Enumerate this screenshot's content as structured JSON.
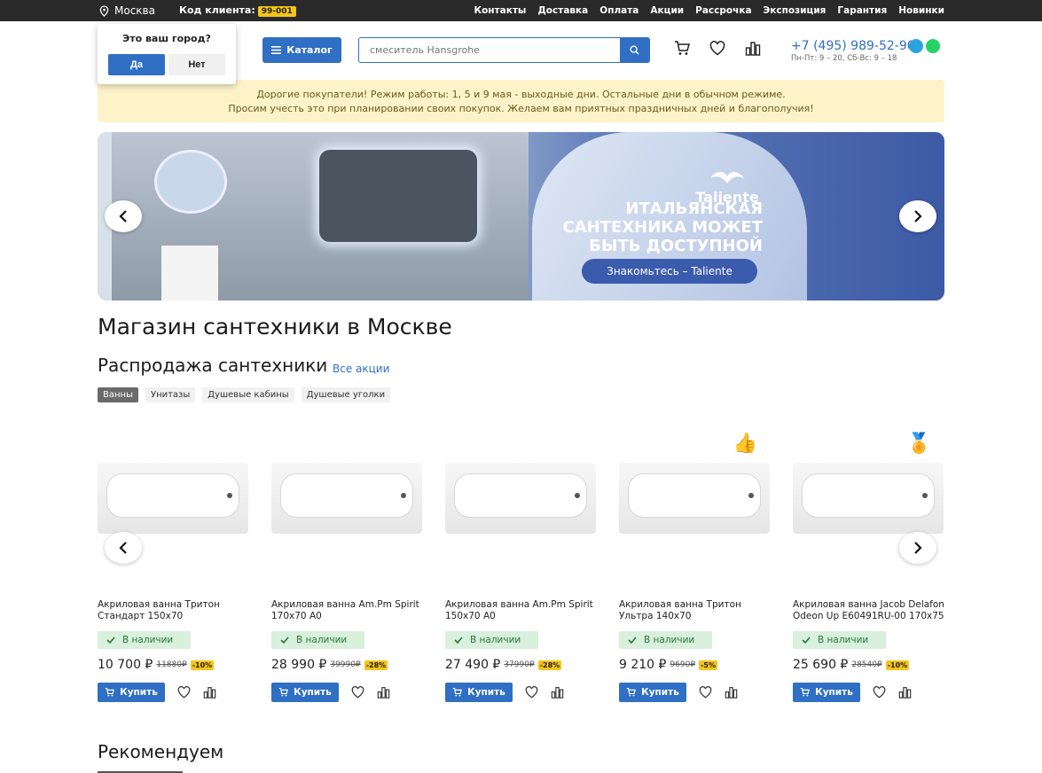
{
  "topbar": {
    "city": "Москва",
    "client_label": "Код клиента:",
    "client_code": "99-001",
    "nav": [
      "Контакты",
      "Доставка",
      "Оплата",
      "Акции",
      "Рассрочка",
      "Экспозиция",
      "Гарантия",
      "Новинки"
    ]
  },
  "city_popup": {
    "question": "Это ваш город?",
    "yes": "Да",
    "no": "Нет"
  },
  "header": {
    "catalog_label": "Каталог",
    "search_placeholder": "смеситель Hansgrohe",
    "phone": "+7 (495) 989-52-90",
    "hours": "Пн-Пт: 9 – 20, Сб-Вс: 9 – 18"
  },
  "notice": {
    "line1": "Дорогие покупатели! Режим работы: 1, 5 и 9 мая - выходные дни. Остальные дни в обычном режиме.",
    "line2": "Просим учесть это при планировании своих покупок. Желаем вам приятных праздничных дней и благополучия!"
  },
  "banner": {
    "brand": "Taliente",
    "slogan_line1": "ИТАЛЬЯНСКАЯ",
    "slogan_line2": "САНТЕХНИКА МОЖЕТ",
    "slogan_line3": "БЫТЬ ДОСТУПНОЙ",
    "cta": "Знакомьтесь – Taliente"
  },
  "page_title": "Магазин сантехники в Москве",
  "sale": {
    "title": "Распродажа сантехники",
    "all_link": "Все акции",
    "categories": [
      "Ванны",
      "Унитазы",
      "Душевые кабины",
      "Душевые уголки"
    ],
    "active_category": "Ванны"
  },
  "products": [
    {
      "name": "Акриловая ванна Тритон Стандарт 150х70",
      "stock": "В наличии",
      "price": "10 700 ₽",
      "old": "11880₽",
      "discount": "-10%",
      "badge": ""
    },
    {
      "name": "Акриловая ванна Am.Pm Spirit 170x70 A0",
      "stock": "В наличии",
      "price": "28 990 ₽",
      "old": "39990₽",
      "discount": "-28%",
      "badge": ""
    },
    {
      "name": "Акриловая ванна Am.Pm Spirit 150x70 A0",
      "stock": "В наличии",
      "price": "27 490 ₽",
      "old": "37990₽",
      "discount": "-28%",
      "badge": ""
    },
    {
      "name": "Акриловая ванна Тритон Ультра 140х70",
      "stock": "В наличии",
      "price": "9 210 ₽",
      "old": "9690₽",
      "discount": "-5%",
      "badge": "👍"
    },
    {
      "name": "Акриловая ванна Jacob Delafon Odeon Up E60491RU-00 170x75",
      "stock": "В наличии",
      "price": "25 690 ₽",
      "old": "28540₽",
      "discount": "-10%",
      "badge": "🏅"
    }
  ],
  "buy_label": "Купить",
  "recommend_title": "Рекомендуем",
  "colors": {
    "accent": "#2f6fc4",
    "notice_bg": "#fdf3c9",
    "stock_bg": "#d8f0dc",
    "discount": "#f5c518"
  }
}
